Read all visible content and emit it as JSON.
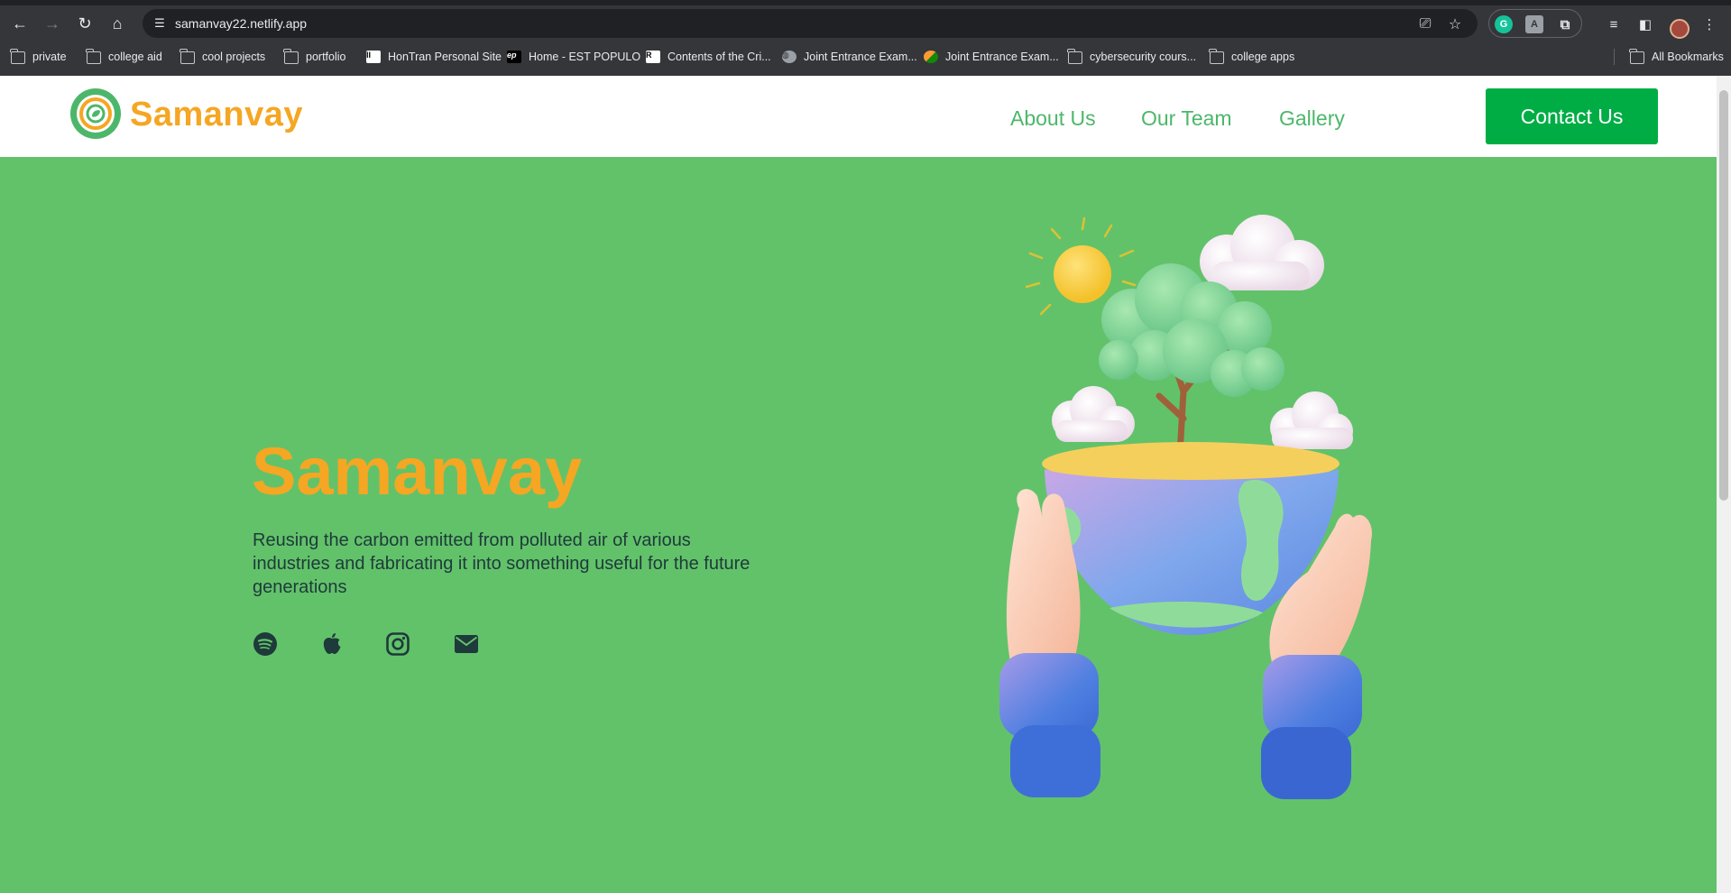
{
  "browser": {
    "url": "samanvay22.netlify.app",
    "bookmarks": [
      {
        "label": "private",
        "type": "folder"
      },
      {
        "label": "college aid",
        "type": "folder"
      },
      {
        "label": "cool projects",
        "type": "folder"
      },
      {
        "label": "portfolio",
        "type": "folder"
      },
      {
        "label": "HonTran Personal Site",
        "type": "site"
      },
      {
        "label": "Home - EST POPULO",
        "type": "site"
      },
      {
        "label": "Contents of the Cri...",
        "type": "site"
      },
      {
        "label": "Joint Entrance Exam...",
        "type": "site"
      },
      {
        "label": "Joint Entrance Exam...",
        "type": "site"
      },
      {
        "label": "cybersecurity cours...",
        "type": "folder"
      },
      {
        "label": "college apps",
        "type": "folder"
      }
    ],
    "all_bookmarks": "All Bookmarks"
  },
  "site": {
    "logo_text": "Samanvay",
    "nav": [
      {
        "label": "About Us"
      },
      {
        "label": "Our Team"
      },
      {
        "label": "Gallery"
      }
    ],
    "contact_label": "Contact Us"
  },
  "hero": {
    "title": "Samanvay",
    "description": "Reusing the carbon emitted from polluted air of various industries and fabricating it into something useful for the future generations",
    "social_icons": [
      "spotify-icon",
      "apple-icon",
      "instagram-icon",
      "mail-icon"
    ]
  },
  "colors": {
    "hero_bg": "#62c26a",
    "brand_orange": "#f5a623",
    "nav_green": "#4cb76a",
    "contact_green": "#00ad45",
    "text_dark": "#1e3a3a"
  }
}
